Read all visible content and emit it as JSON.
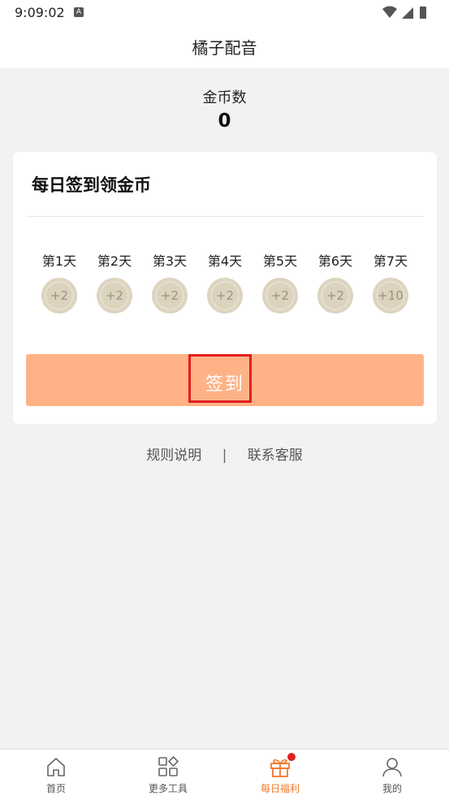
{
  "status_bar": {
    "time": "9:09:02",
    "notification_letter": "A"
  },
  "app_bar": {
    "title": "橘子配音"
  },
  "coins": {
    "label": "金币数",
    "count": "0"
  },
  "card": {
    "title": "每日签到领金币",
    "days": [
      {
        "label": "第1天",
        "reward": "+2"
      },
      {
        "label": "第2天",
        "reward": "+2"
      },
      {
        "label": "第3天",
        "reward": "+2"
      },
      {
        "label": "第4天",
        "reward": "+2"
      },
      {
        "label": "第5天",
        "reward": "+2"
      },
      {
        "label": "第6天",
        "reward": "+2"
      },
      {
        "label": "第7天",
        "reward": "+10"
      }
    ],
    "signin_button": "签到"
  },
  "links": {
    "rules": "规则说明",
    "separator": "|",
    "support": "联系客服"
  },
  "tabbar": {
    "items": [
      {
        "label": "首页",
        "icon": "home-icon"
      },
      {
        "label": "更多工具",
        "icon": "grid-icon"
      },
      {
        "label": "每日福利",
        "icon": "gift-icon",
        "active": true
      },
      {
        "label": "我的",
        "icon": "user-icon"
      }
    ]
  },
  "colors": {
    "accent": "#f07a2b",
    "button": "#ffb286",
    "highlight": "#e21f1f"
  }
}
